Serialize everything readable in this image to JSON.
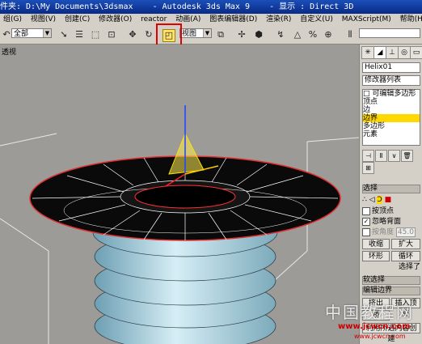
{
  "window": {
    "title": "件夹: D:\\My Documents\\3dsmax    - Autodesk 3ds Max 9    - 显示 : Direct 3D"
  },
  "menu": {
    "items": [
      "组(G)",
      "视图(V)",
      "创建(C)",
      "修改器(O)",
      "reactor",
      "动画(A)",
      "图表编辑器(D)",
      "渲染(R)",
      "自定义(U)",
      "MAXScript(M)",
      "帮助(H)"
    ]
  },
  "toolbar": {
    "selection_filter": "全部",
    "ref_coord": "视图",
    "highlighted_tool": "select-and-scale"
  },
  "viewport": {
    "label": "透视"
  },
  "panel": {
    "tabs": [
      "create",
      "modify",
      "hierarchy",
      "motion",
      "display",
      "utilities"
    ],
    "object_name": "Helix01",
    "modifier_list": "修改器列表",
    "stack": [
      {
        "label": "□ 可编辑多边形",
        "selected": false
      },
      {
        "label": "    顶点",
        "selected": false
      },
      {
        "label": "    边",
        "selected": false
      },
      {
        "label": "    边界",
        "selected": true
      },
      {
        "label": "    多边形",
        "selected": false
      },
      {
        "label": "    元素",
        "selected": false
      }
    ],
    "selection_rollout": "选择",
    "by_vertex": "按顶点",
    "ignore_backfacing": "忽略背面",
    "by_angle": "按角度",
    "angle_value": "45.0",
    "shrink": "收缩",
    "grow": "扩大",
    "ring": "环形",
    "loop": "循环",
    "selected_text": "选择了",
    "soft_selection": "软选择",
    "edit_borders": "编辑边界",
    "extrude": "挤出",
    "insert_vertex": "插入顶点",
    "bridge": "桥",
    "create_shape": "利用所选内容创建"
  },
  "watermark": {
    "line1": "中国教程网",
    "line2": "www.jcwcn.com",
    "line3": "www.jcwcn.com"
  },
  "colors": {
    "accent_highlight": "#e00000",
    "selection_yellow": "#ffd800",
    "object_cyan": "#a9d7e6"
  }
}
